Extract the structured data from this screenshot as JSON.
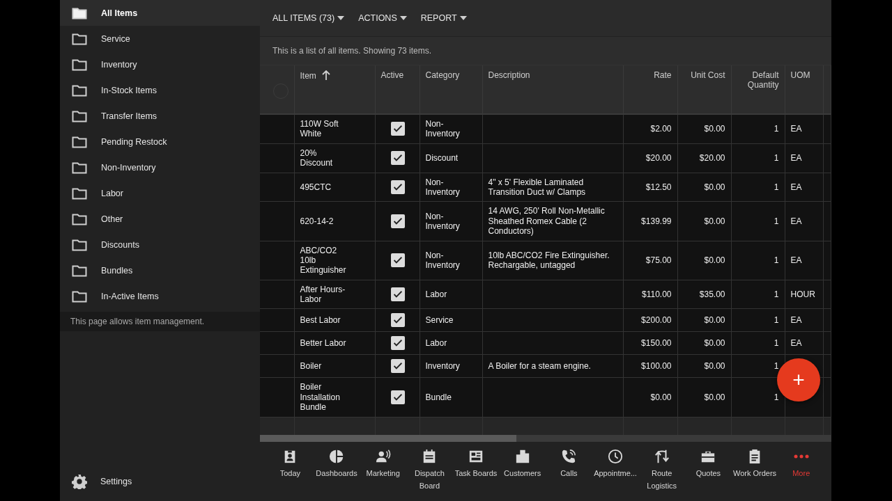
{
  "sidebar": {
    "items": [
      {
        "label": "All Items",
        "selected": true
      },
      {
        "label": "Service",
        "selected": false
      },
      {
        "label": "Inventory",
        "selected": false
      },
      {
        "label": "In-Stock Items",
        "selected": false
      },
      {
        "label": "Transfer Items",
        "selected": false
      },
      {
        "label": "Pending Restock",
        "selected": false
      },
      {
        "label": "Non-Inventory",
        "selected": false
      },
      {
        "label": "Labor",
        "selected": false
      },
      {
        "label": "Other",
        "selected": false
      },
      {
        "label": "Discounts",
        "selected": false
      },
      {
        "label": "Bundles",
        "selected": false
      },
      {
        "label": "In-Active Items",
        "selected": false
      }
    ],
    "note": "This page allows item management.",
    "settings": "Settings"
  },
  "toolbar": {
    "menus": [
      "ALL ITEMS (73)",
      "ACTIONS",
      "REPORT"
    ]
  },
  "info": "This is a list of all items. Showing 73 items.",
  "table": {
    "select_all": {
      "checked": false
    },
    "columns": [
      {
        "label": "Item"
      },
      {
        "label": "Active"
      },
      {
        "label": "Category"
      },
      {
        "label": "Description"
      },
      {
        "label": "Rate"
      },
      {
        "label": "Unit Cost"
      },
      {
        "label": "Default Quantity"
      },
      {
        "label": "UOM"
      }
    ],
    "rows": [
      {
        "item": "110W Soft White",
        "active": true,
        "category": "Non-Inventory",
        "description": "",
        "rate": "$2.00",
        "unit_cost": "$0.00",
        "default_quantity": "1",
        "uom": "EA"
      },
      {
        "item": "20% Discount",
        "active": true,
        "category": "Discount",
        "description": "",
        "rate": "$20.00",
        "unit_cost": "$20.00",
        "default_quantity": "1",
        "uom": "EA"
      },
      {
        "item": "495CTC",
        "active": true,
        "category": "Non-Inventory",
        "description": "4\" x 5' Flexible Laminated Transition Duct w/ Clamps",
        "rate": "$12.50",
        "unit_cost": "$0.00",
        "default_quantity": "1",
        "uom": "EA"
      },
      {
        "item": "620-14-2",
        "active": true,
        "category": "Non-Inventory",
        "description": "14 AWG, 250' Roll Non-Metallic Sheathed Romex Cable (2 Conductors)",
        "rate": "$139.99",
        "unit_cost": "$0.00",
        "default_quantity": "1",
        "uom": "EA"
      },
      {
        "item": "ABC/CO2 10lb Extinguisher",
        "active": true,
        "category": "Non-Inventory",
        "description": "10lb ABC/CO2 Fire Extinguisher. Rechargable, untagged",
        "rate": "$75.00",
        "unit_cost": "$0.00",
        "default_quantity": "1",
        "uom": "EA"
      },
      {
        "item": "After Hours-Labor",
        "active": true,
        "category": "Labor",
        "description": "",
        "rate": "$110.00",
        "unit_cost": "$35.00",
        "default_quantity": "1",
        "uom": "HOUR"
      },
      {
        "item": "Best Labor",
        "active": true,
        "category": "Service",
        "description": "",
        "rate": "$200.00",
        "unit_cost": "$0.00",
        "default_quantity": "1",
        "uom": "EA"
      },
      {
        "item": "Better Labor",
        "active": true,
        "category": "Labor",
        "description": "",
        "rate": "$150.00",
        "unit_cost": "$0.00",
        "default_quantity": "1",
        "uom": "EA"
      },
      {
        "item": "Boiler",
        "active": true,
        "category": "Inventory",
        "description": "A Boiler for a steam engine.",
        "rate": "$100.00",
        "unit_cost": "$0.00",
        "default_quantity": "1",
        "uom": ""
      },
      {
        "item": "Boiler Installation Bundle",
        "active": true,
        "category": "Bundle",
        "description": "",
        "rate": "$0.00",
        "unit_cost": "$0.00",
        "default_quantity": "1",
        "uom": ""
      }
    ]
  },
  "fab": {
    "label": "+"
  },
  "nav": [
    {
      "label": "Today",
      "kind": "badge",
      "color": "#d8d8d8"
    },
    {
      "label": "Dashboards",
      "kind": "pie",
      "color": "#d8d8d8"
    },
    {
      "label": "Marketing",
      "kind": "speaker",
      "color": "#d8d8d8"
    },
    {
      "label": "Dispatch Board",
      "kind": "calendar",
      "color": "#d8d8d8"
    },
    {
      "label": "Task Boards",
      "kind": "board",
      "color": "#d8d8d8"
    },
    {
      "label": "Customers",
      "kind": "building",
      "color": "#d8d8d8"
    },
    {
      "label": "Calls",
      "kind": "phone",
      "color": "#d8d8d8"
    },
    {
      "label": "Appointme...",
      "kind": "clock",
      "color": "#d8d8d8"
    },
    {
      "label": "Route Logistics",
      "kind": "route",
      "color": "#d8d8d8"
    },
    {
      "label": "Quotes",
      "kind": "briefcase",
      "color": "#d8d8d8"
    },
    {
      "label": "Work Orders",
      "kind": "clipboard",
      "color": "#d8d8d8"
    },
    {
      "label": "More",
      "kind": "dots",
      "color": "#e53935"
    }
  ]
}
